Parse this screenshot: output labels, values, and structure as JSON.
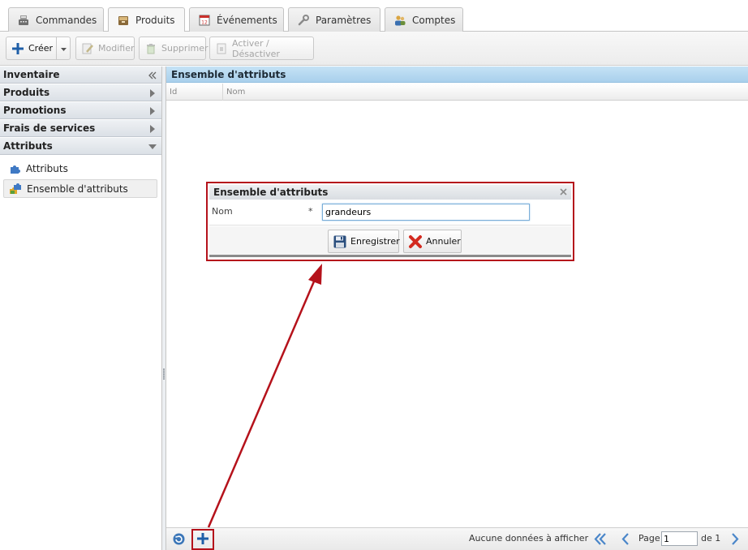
{
  "tabs": [
    {
      "label": "Commandes",
      "icon": "cash-register-icon"
    },
    {
      "label": "Produits",
      "icon": "box-icon",
      "active": true
    },
    {
      "label": "Événements",
      "icon": "calendar-icon"
    },
    {
      "label": "Paramètres",
      "icon": "wrench-icon"
    },
    {
      "label": "Comptes",
      "icon": "users-icon"
    }
  ],
  "toolbar": {
    "create_label": "Créer",
    "edit_label": "Modifier",
    "delete_label": "Supprimer",
    "toggle_label": "Activer / Désactiver"
  },
  "sidebar": {
    "sections": [
      {
        "label": "Inventaire"
      },
      {
        "label": "Produits"
      },
      {
        "label": "Promotions"
      },
      {
        "label": "Frais de services"
      },
      {
        "label": "Attributs",
        "expanded": true
      }
    ],
    "items": [
      {
        "label": "Attributs",
        "icon": "puzzle-icon"
      },
      {
        "label": "Ensemble d'attributs",
        "icon": "puzzle-set-icon",
        "selected": true
      }
    ]
  },
  "grid": {
    "title": "Ensemble d'attributs",
    "columns": [
      "Id",
      "Nom"
    ]
  },
  "pager": {
    "message": "Aucune données à afficher",
    "page_label": "Page",
    "page_value": "1",
    "of_label": "de 1"
  },
  "dialog": {
    "title": "Ensemble d'attributs",
    "field_label": "Nom",
    "required_mark": "*",
    "field_value": "grandeurs",
    "save_label": "Enregistrer",
    "cancel_label": "Annuler"
  },
  "colors": {
    "annotation": "#b5121b",
    "grid_header": "#b8daf1"
  }
}
